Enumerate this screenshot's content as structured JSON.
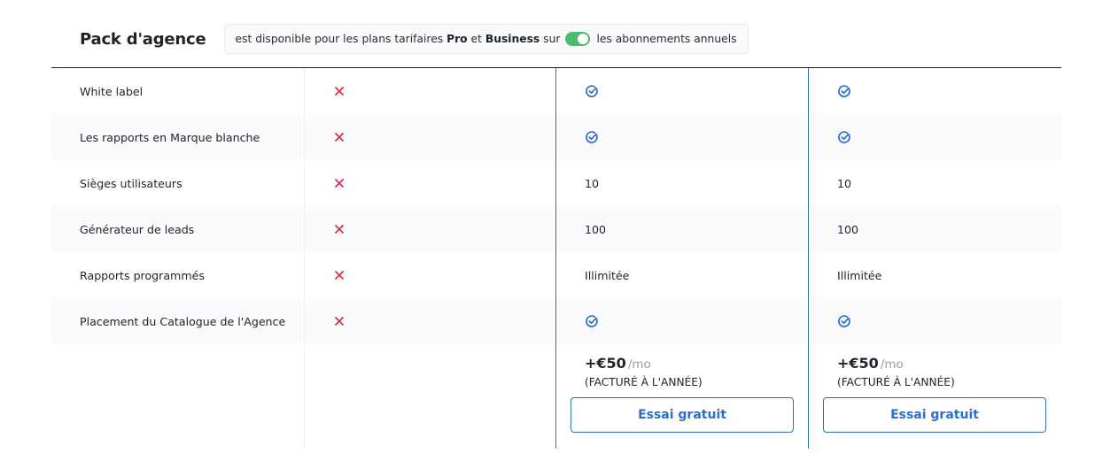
{
  "header": {
    "title": "Pack d'agence",
    "badge": {
      "text_before": "est disponible pour les plans tarifaires ",
      "plan_1": "Pro",
      "connector": " et ",
      "plan_2": "Business",
      "text_mid": " sur",
      "toggle_on": true,
      "text_after": "les abonnements annuels"
    }
  },
  "colors": {
    "cross": "#d9344a",
    "check": "#2a6fcb",
    "toggle": "#4cbb6c",
    "plan_border": "#2d6fb8"
  },
  "features": [
    {
      "label": "White label",
      "col1": "cross-icon",
      "col2": "check-icon",
      "col3": "check-icon"
    },
    {
      "label": "Les rapports en Marque blanche",
      "col1": "cross-icon",
      "col2": "check-icon",
      "col3": "check-icon"
    },
    {
      "label": "Sièges utilisateurs",
      "col1": "cross-icon",
      "col2": "10",
      "col3": "10"
    },
    {
      "label": "Générateur de leads",
      "col1": "cross-icon",
      "col2": "100",
      "col3": "100"
    },
    {
      "label": "Rapports programmés",
      "col1": "cross-icon",
      "col2": "Illimitée",
      "col3": "Illimitée"
    },
    {
      "label": "Placement du Catalogue de l'Agence",
      "col1": "cross-icon",
      "col2": "check-icon",
      "col3": "check-icon"
    }
  ],
  "plans": [
    {
      "price": "+€50",
      "period": "/mo",
      "billing": "(FACTURÉ À L'ANNÉE)",
      "cta": "Essai gratuit"
    },
    {
      "price": "+€50",
      "period": "/mo",
      "billing": "(FACTURÉ À L'ANNÉE)",
      "cta": "Essai gratuit"
    }
  ]
}
